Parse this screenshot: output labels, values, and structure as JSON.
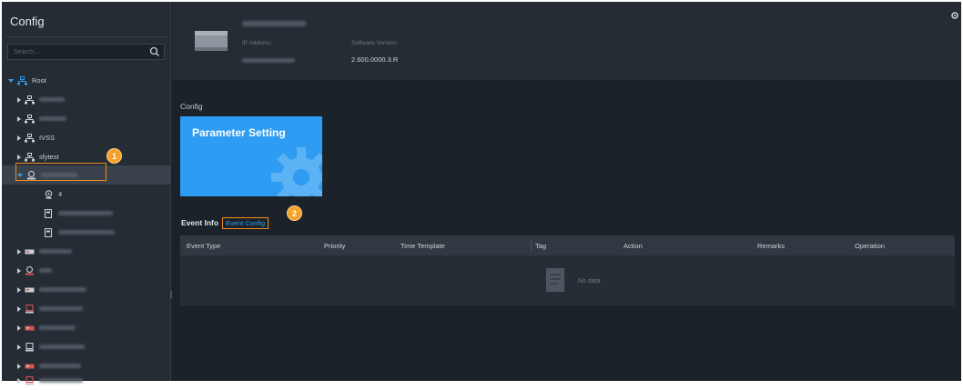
{
  "sidebar": {
    "title": "Config",
    "search_placeholder": "Search...",
    "root_label": "Root",
    "items": [
      {
        "label": "",
        "icon": "org-icon",
        "expanded": false
      },
      {
        "label": "",
        "icon": "org-icon",
        "expanded": false
      },
      {
        "label": "IVSS",
        "icon": "org-icon",
        "expanded": false
      },
      {
        "label": "sfytest",
        "icon": "org-icon",
        "expanded": false
      },
      {
        "label": "",
        "icon": "device-icon",
        "expanded": true,
        "selected": true
      },
      {
        "label": "4",
        "icon": "channel-icon"
      },
      {
        "label": "",
        "icon": "alarm-input-icon"
      },
      {
        "label": "",
        "icon": "alarm-input-icon"
      },
      {
        "label": "",
        "icon": "nvr-icon"
      },
      {
        "label": "",
        "icon": "device-icon"
      },
      {
        "label": "",
        "icon": "nvr-icon"
      },
      {
        "label": "",
        "icon": "device-red-icon"
      },
      {
        "label": "",
        "icon": "nvr-red-icon"
      },
      {
        "label": "",
        "icon": "device-icon"
      },
      {
        "label": "",
        "icon": "nvr-red-icon"
      },
      {
        "label": "",
        "icon": "device-icon"
      }
    ]
  },
  "device": {
    "name": "",
    "ip_label": "IP Address:",
    "ip_value": "",
    "software_label": "Software Version:",
    "software_value": "2.600.0000.3.R"
  },
  "config": {
    "section_label": "Config",
    "tile_title": "Parameter Setting"
  },
  "tabs": {
    "event_info": "Event Info",
    "event_config": "Event Config"
  },
  "table": {
    "columns": [
      "Event Type",
      "Priority",
      "Time Template",
      "Tag",
      "Action",
      "Remarks",
      "Operation"
    ],
    "empty_text": "No data"
  },
  "callouts": [
    "1",
    "2"
  ],
  "colors": {
    "accent": "#2d9cf2",
    "highlight": "#f08a22",
    "callout": "#f5a12a",
    "background": "#1c2229",
    "panel": "#252c34"
  }
}
